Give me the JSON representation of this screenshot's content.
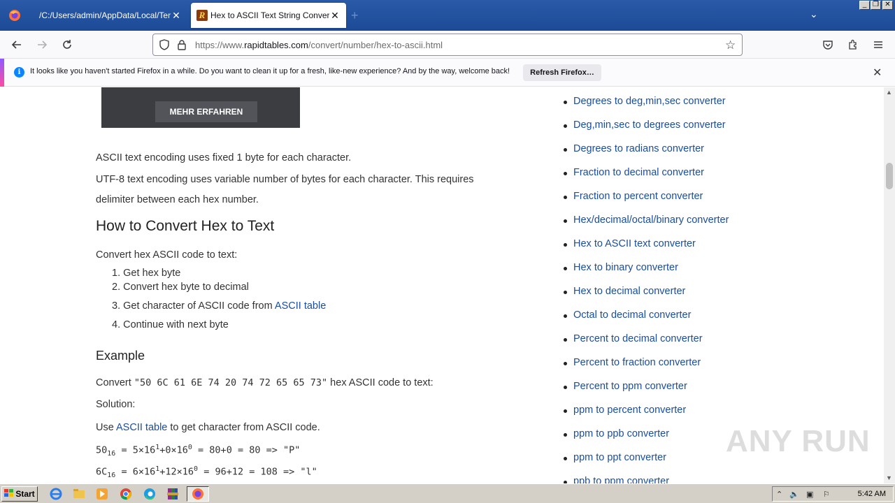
{
  "tabs": [
    {
      "title": "/C:/Users/admin/AppData/Local/Temp/f",
      "active": false
    },
    {
      "title": "Hex to ASCII Text String Converte",
      "active": true,
      "favicon": "R"
    }
  ],
  "newtab_label": "+",
  "nav": {
    "url_prefix": "https://www.",
    "url_domain": "rapidtables.com",
    "url_path": "/convert/number/hex-to-ascii.html"
  },
  "notification": {
    "text": "It looks like you haven't started Firefox in a while. Do you want to clean it up for a fresh, like-new experience? And by the way, welcome back!",
    "button": "Refresh Firefox…"
  },
  "ad": {
    "button": "MEHR ERFAHREN"
  },
  "article": {
    "p1": "ASCII text encoding uses fixed 1 byte for each character.",
    "p2a": "UTF-8 text encoding uses variable number of bytes for each character. This requires",
    "p2b": "delimiter between each hex number.",
    "h_how": "How to Convert Hex to Text",
    "intro": "Convert hex ASCII code to text:",
    "steps": [
      "1. Get hex byte",
      "2. Convert hex byte to decimal",
      "3. Get character of ASCII code from ",
      "4. Continue with next byte"
    ],
    "ascii_table_link": "ASCII table",
    "h_example": "Example",
    "convert_prefix": "Convert ",
    "convert_code": "\"50 6C 61 6E 74 20 74 72 65 65 73\"",
    "convert_suffix": " hex ASCII code to text:",
    "solution": "Solution:",
    "use_prefix": "Use ",
    "use_suffix": " to get character from ASCII code.",
    "calc1_base": "50",
    "calc1_rest": " = 5×16",
    "calc1_rest2": "+0×16",
    "calc1_end": " = 80+0 = 80 => \"P\"",
    "calc2_base": "6C",
    "calc2_rest": " = 6×16",
    "calc2_rest2": "+12×16",
    "calc2_end": " = 96+12 = 108 => \"l\"",
    "sub16": "16",
    "sup1": "1",
    "sup0": "0"
  },
  "sidebar": [
    "Degrees to deg,min,sec converter",
    "Deg,min,sec to degrees converter",
    "Degrees to radians converter",
    "Fraction to decimal converter",
    "Fraction to percent converter",
    "Hex/decimal/octal/binary converter",
    "Hex to ASCII text converter",
    "Hex to binary converter",
    "Hex to decimal converter",
    "Octal to decimal converter",
    "Percent to decimal converter",
    "Percent to fraction converter",
    "Percent to ppm converter",
    "ppm to percent converter",
    "ppm to ppb converter",
    "ppm to ppt converter",
    "ppb to ppm converter"
  ],
  "watermark": "ANY RUN",
  "taskbar": {
    "start": "Start",
    "clock": "5:42 AM"
  }
}
